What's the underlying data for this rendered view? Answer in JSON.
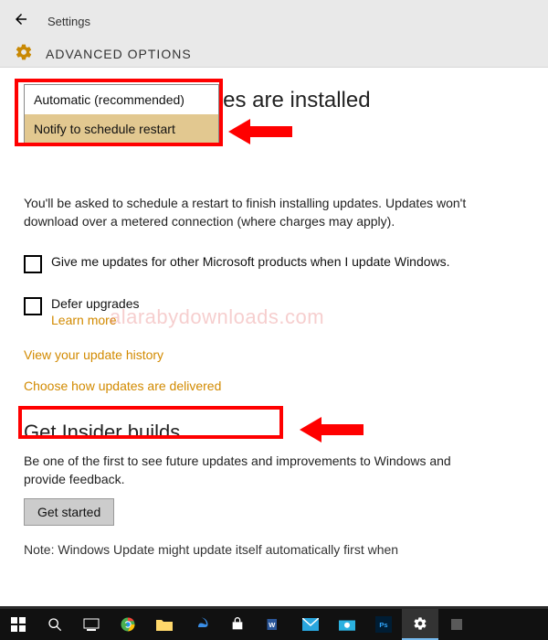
{
  "header": {
    "settings_label": "Settings",
    "page_title": "ADVANCED OPTIONS"
  },
  "dropdown": {
    "option1": "Automatic (recommended)",
    "option2": "Notify to schedule restart"
  },
  "heading_behind": "Choose how updates are installed",
  "body_text": "You'll be asked to schedule a restart to finish installing updates. Updates won't download over a metered connection (where charges may apply).",
  "checkbox1_label": "Give me updates for other Microsoft products when I update Windows.",
  "checkbox2_label": "Defer upgrades",
  "learn_more": "Learn more",
  "link_history": "View your update history",
  "link_delivered": "Choose how updates are delivered",
  "insider_heading": "Get Insider builds",
  "insider_text": "Be one of the first to see future updates and improvements to Windows and provide feedback.",
  "get_started_btn": "Get started",
  "note_text": "Note: Windows Update might update itself automatically first when",
  "watermark": "alarabydownloads.com",
  "taskbar": {
    "start": "start-icon",
    "search": "search-icon",
    "taskview": "taskview-icon",
    "chrome": "chrome-icon",
    "folder": "folder-icon",
    "edge": "edge-icon",
    "store": "store-icon",
    "word": "word-icon",
    "mail": "mail-icon",
    "camera": "camera-icon",
    "ps": "photoshop-icon",
    "settings": "settings-icon",
    "misc": "app-icon"
  }
}
